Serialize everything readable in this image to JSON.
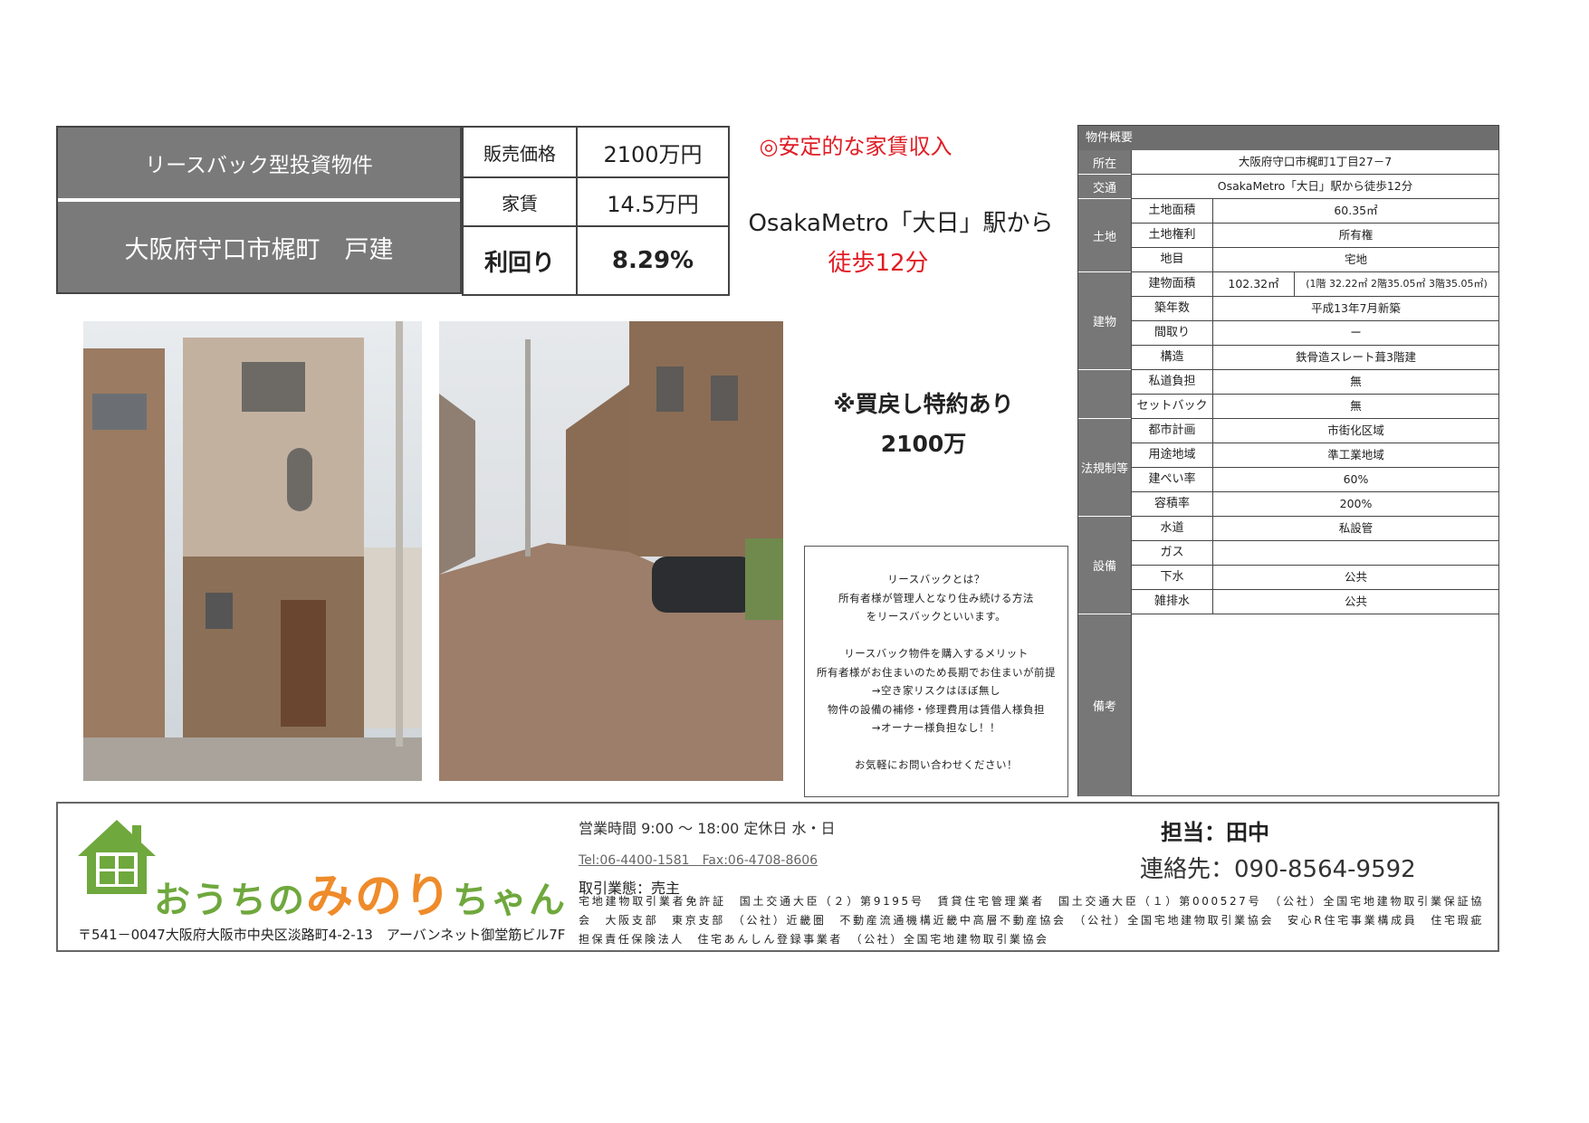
{
  "header": {
    "category": "リースバック型投資物件",
    "address_title": "大阪府守口市梶町　戸建",
    "price_label": "販売価格",
    "price_value": "2100万円",
    "rent_label": "家賃",
    "rent_value": "14.5万円",
    "yield_label": "利回り",
    "yield_value": "8.29%"
  },
  "highlights": {
    "income": "◎安定的な家賃収入",
    "station": "OsakaMetro「大日」駅から",
    "walk": "徒歩12分",
    "buyback_line1": "※買戻し特約あり",
    "buyback_line2": "2100万"
  },
  "note": {
    "lines": [
      "リースバックとは？",
      "所有者様が管理人となり住み続ける方法",
      "をリースバックといいます。",
      "",
      "リースバック物件を購入するメリット",
      "所有者様がお住まいのため長期でお住まいが前提",
      "→空き家リスクはほぼ無し",
      "物件の設備の補修・修理費用は賃借人様負担",
      "→オーナー様負担なし！！",
      "",
      "お気軽にお問い合わせください！"
    ]
  },
  "overview": {
    "title": "物件概要",
    "location_label": "所在",
    "location_value": "大阪府守口市梶町1丁目27－7",
    "transport_label": "交通",
    "transport_value": "OsakaMetro「大日」駅から徒歩12分",
    "land_group": "土地",
    "land_area_label": "土地面積",
    "land_area_value": "60.35㎡",
    "land_right_label": "土地権利",
    "land_right_value": "所有権",
    "land_type_label": "地目",
    "land_type_value": "宅地",
    "building_group": "建物",
    "building_area_label": "建物面積",
    "building_area_value": "102.32㎡",
    "building_area_detail": "(1階 32.22㎡ 2階35.05㎡ 3階35.05㎡)",
    "age_label": "築年数",
    "age_value": "平成13年7月新築",
    "layout_label": "間取り",
    "layout_value": "ー",
    "structure_label": "構造",
    "structure_value": "鉄骨造スレート葺3階建",
    "private_road_label": "私道負担",
    "private_road_value": "無",
    "setback_label": "セットバック",
    "setback_value": "無",
    "law_group": "法規制等",
    "city_plan_label": "都市計画",
    "city_plan_value": "市街化区域",
    "zoning_label": "用途地域",
    "zoning_value": "準工業地域",
    "coverage_label": "建ぺい率",
    "coverage_value": "60%",
    "far_label": "容積率",
    "far_value": "200%",
    "facility_group": "設備",
    "water_label": "水道",
    "water_value": "私設管",
    "gas_label": "ガス",
    "gas_value": "",
    "sewer_label": "下水",
    "sewer_value": "公共",
    "drain_label": "雑排水",
    "drain_value": "公共",
    "remarks_label": "備考"
  },
  "footer": {
    "logo_green": "おうちの",
    "logo_orange": "みのり",
    "logo_green2": "ちゃん",
    "hours": "営業時間 9:00 〜 18:00  定休日 水・日",
    "tel_fax": "Tel:06-4400-1581　Fax:06-4708-8606",
    "trade_type": "取引業態：売主",
    "license": "宅地建物取引業者免許証　国土交通大臣（２）第9195号　賃貸住宅管理業者　国土交通大臣（１）第000527号　（公社）全国宅地建物取引業保証協会　大阪支部　東京支部　（公社）近畿圏　不動産流通機構近畿中高層不動産協会　（公社）全国宅地建物取引業協会　安心R住宅事業構成員　住宅瑕疵担保責任保険法人　住宅あんしん登録事業者　（公社）全国宅地建物取引業協会",
    "agent": "担当：田中",
    "contact": "連絡先：090-8564-9592",
    "address": "〒541－0047大阪府大阪市中央区淡路町4-2-13　アーバンネット御堂筋ビル7F"
  },
  "colors": {
    "accent_red": "#e11c24",
    "header_gray": "#7a7a7a",
    "logo_green": "#6fa83d",
    "logo_orange": "#ef8b2a"
  }
}
